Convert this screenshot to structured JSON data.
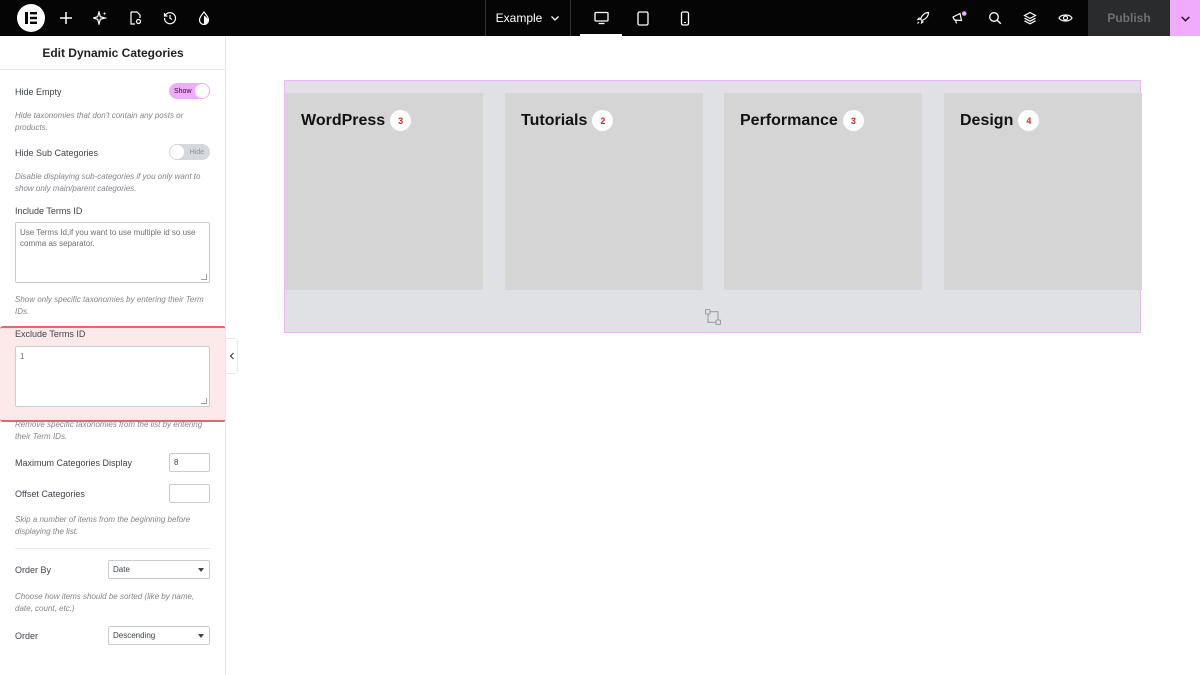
{
  "topbar": {
    "document_title": "Example",
    "publish_label": "Publish",
    "icons": [
      "elementor-logo-icon",
      "add-icon",
      "ai-sparkle-icon",
      "page-settings-icon",
      "history-icon",
      "site-settings-drop-icon",
      "chevron-down-icon",
      "desktop-icon",
      "tablet-icon",
      "mobile-icon",
      "rocket-icon",
      "megaphone-icon",
      "search-icon",
      "layers-icon",
      "eye-icon"
    ],
    "accent": "#f0abfc"
  },
  "panel": {
    "title": "Edit Dynamic Categories",
    "hide_empty": {
      "label": "Hide Empty",
      "state": "Show",
      "description": "Hide taxonomies that don't contain any posts or products."
    },
    "hide_sub": {
      "label": "Hide Sub Categories",
      "state": "Hide",
      "description": "Disable displaying sub-categories if you only want to show only main/parent categories."
    },
    "include_terms": {
      "label": "Include Terms ID",
      "placeholder": "Use Terms Id,if you want to use multiple id so use comma as separator.",
      "description": "Show only specific taxonomies by entering their Term IDs."
    },
    "exclude_terms": {
      "label": "Exclude Terms ID",
      "value": "1",
      "description": "Remove specific taxonomies from the list by entering their Term IDs."
    },
    "max_display": {
      "label": "Maximum Categories Display",
      "value": "8"
    },
    "offset": {
      "label": "Offset Categories",
      "value": "",
      "description": "Skip a number of items from the beginning before displaying the list."
    },
    "order_by": {
      "label": "Order By",
      "value": "Date",
      "description": "Choose how items should be sorted (like by name, date, count, etc.)"
    },
    "order": {
      "label": "Order",
      "value": "Descending"
    },
    "highlight_color": "#e2676f"
  },
  "canvas": {
    "categories": [
      {
        "name": "WordPress",
        "count": "3"
      },
      {
        "name": "Tutorials",
        "count": "2"
      },
      {
        "name": "Performance",
        "count": "3"
      },
      {
        "name": "Design",
        "count": "4"
      }
    ],
    "count_color": "#e0241b"
  }
}
